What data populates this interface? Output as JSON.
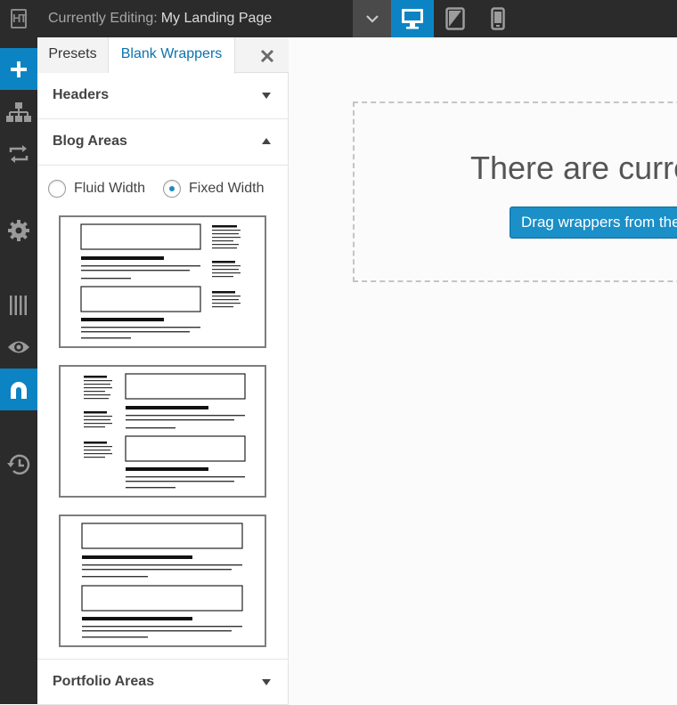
{
  "topbar": {
    "logo_text": "HT",
    "editing_label": "Currently Editing:",
    "page_name": "My Landing Page",
    "devices": [
      "desktop-icon",
      "tablet-icon",
      "phone-icon"
    ],
    "active_device": "desktop",
    "accent_color": "#0c84c4"
  },
  "rail": {
    "items": [
      {
        "icon": "plus-icon",
        "active": true
      },
      {
        "icon": "sitemap-icon",
        "active": false
      },
      {
        "icon": "swap-arrows-icon",
        "active": false
      },
      {
        "icon": "gear-icon",
        "active": false
      },
      {
        "icon": "columns-icon",
        "active": false
      },
      {
        "icon": "eye-icon",
        "active": false
      },
      {
        "icon": "magnet-icon",
        "active": true
      },
      {
        "icon": "history-icon",
        "active": false
      }
    ]
  },
  "panel": {
    "tabs": [
      {
        "label": "Presets",
        "active": false
      },
      {
        "label": "Blank Wrappers",
        "active": true
      }
    ],
    "sections": [
      {
        "title": "Headers",
        "expanded": false
      },
      {
        "title": "Blog Areas",
        "expanded": true
      },
      {
        "title": "Portfolio Areas",
        "expanded": false
      }
    ],
    "width_options": [
      {
        "label": "Fluid Width",
        "selected": false
      },
      {
        "label": "Fixed Width",
        "selected": true
      }
    ],
    "blog_layouts": [
      "layout-sidebar-right",
      "layout-sidebar-left",
      "layout-full-width"
    ]
  },
  "canvas": {
    "empty_message": "There are currently no wrappers on this page.",
    "drag_button": "Drag wrappers from the panel on the left"
  }
}
